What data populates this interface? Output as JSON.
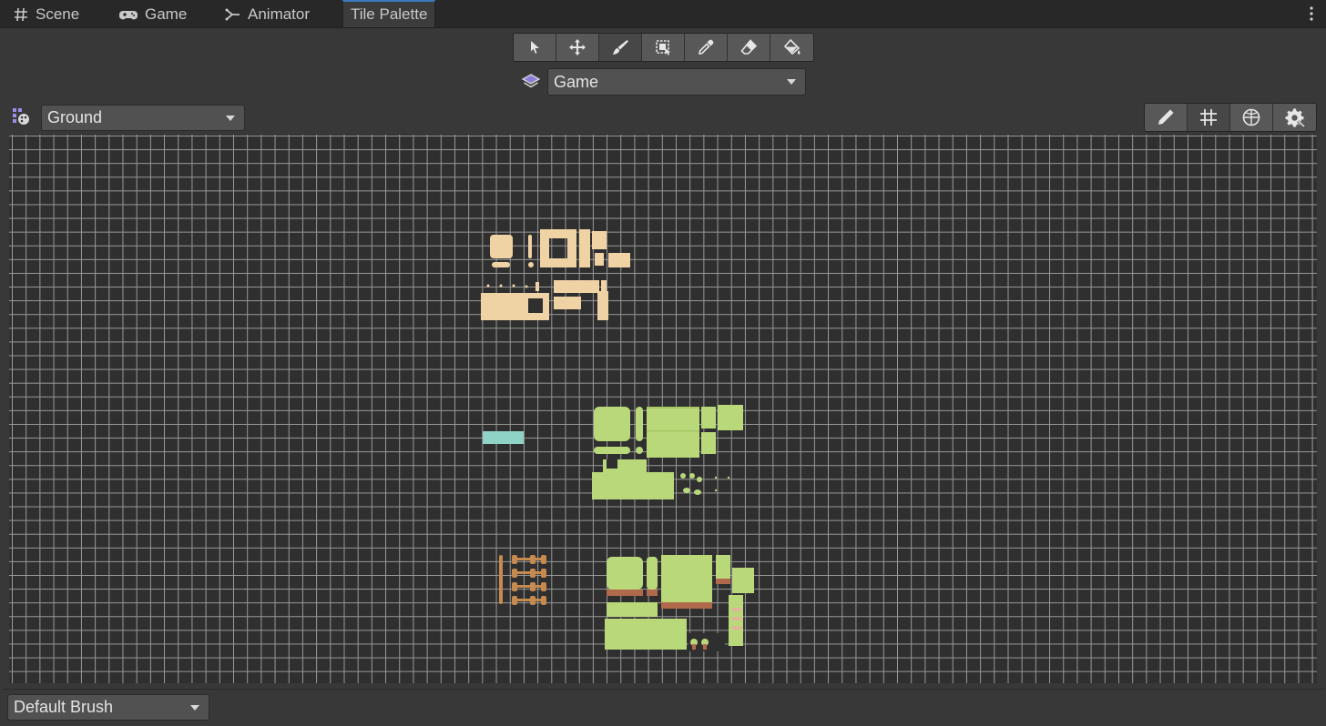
{
  "tabs": [
    {
      "label": "Scene",
      "icon": "hash-icon",
      "active": false
    },
    {
      "label": "Game",
      "icon": "gamepad-icon",
      "active": false
    },
    {
      "label": "Animator",
      "icon": "animator-icon",
      "active": false
    },
    {
      "label": "Tile Palette",
      "icon": "",
      "active": true
    }
  ],
  "toolbar": {
    "tools": [
      {
        "name": "select-tool",
        "icon": "arrow-cursor-icon",
        "selected": false
      },
      {
        "name": "move-tool",
        "icon": "move-arrows-icon",
        "selected": false
      },
      {
        "name": "paint-tool",
        "icon": "brush-icon",
        "selected": true
      },
      {
        "name": "box-fill-tool",
        "icon": "box-fill-icon",
        "selected": false
      },
      {
        "name": "picker-tool",
        "icon": "eyedropper-icon",
        "selected": false
      },
      {
        "name": "erase-tool",
        "icon": "eraser-icon",
        "selected": false
      },
      {
        "name": "fill-tool",
        "icon": "paint-bucket-icon",
        "selected": false
      }
    ]
  },
  "target": {
    "icon": "layers-icon",
    "value": "Game"
  },
  "palette": {
    "icon": "palette-icon",
    "value": "Ground"
  },
  "options": [
    {
      "name": "edit-palette",
      "icon": "pencil-icon",
      "selected": false
    },
    {
      "name": "toggle-grid",
      "icon": "grid-icon",
      "selected": true
    },
    {
      "name": "toggle-gizmos",
      "icon": "gizmo-icon",
      "selected": false
    },
    {
      "name": "palette-settings",
      "icon": "gear-icon",
      "selected": false
    }
  ],
  "brush": {
    "value": "Default Brush"
  },
  "colors": {
    "sand": "#f0d3a4",
    "grass": "#b9d87a",
    "grass_dark": "#9cbf57",
    "water": "#8fd3c6",
    "wood": "#c68a4f",
    "dirt": "#b06a4b",
    "accent": "#3a79bb"
  }
}
